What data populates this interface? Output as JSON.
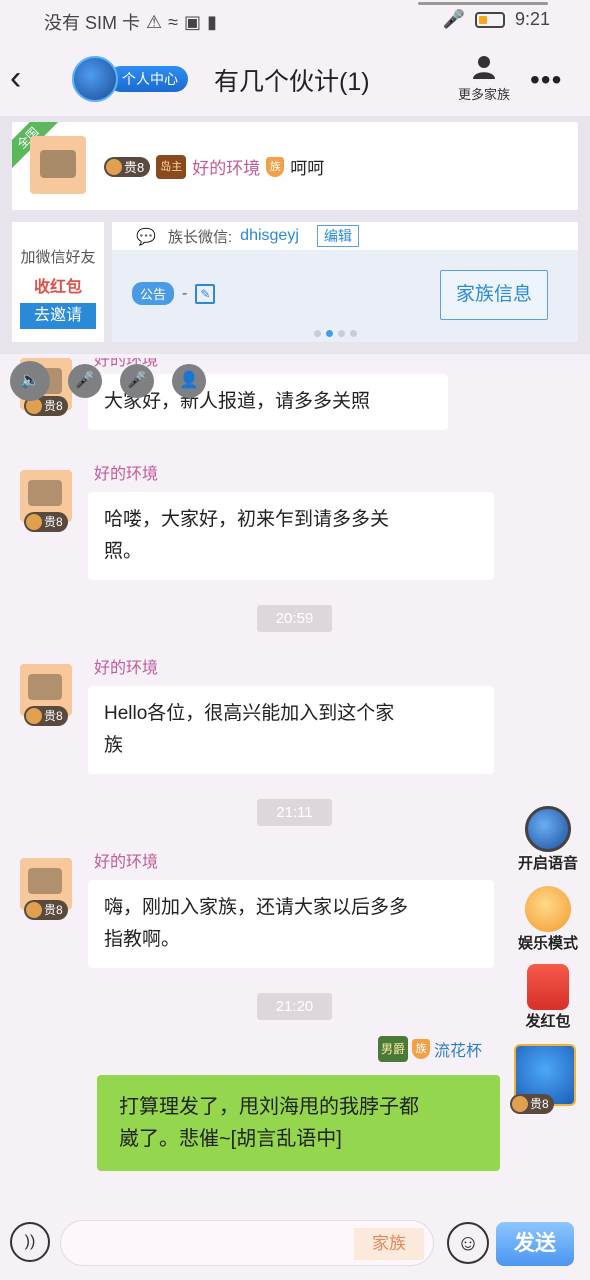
{
  "status_bar": {
    "carrier": "没有 SIM 卡",
    "time": "9:21"
  },
  "header": {
    "profile_label": "个人中心",
    "title": "有几个伙计(1)",
    "more_family": "更多家族"
  },
  "banner": {
    "corner_tag": "全国",
    "gui_level": "贵8",
    "island_badge": "岛主",
    "clan_badge": "族",
    "sender": "好的环境",
    "message": "呵呵",
    "invite_line1": "加微信好友",
    "invite_line2": "收红包",
    "invite_button": "去邀请",
    "wechat_label": "族长微信:",
    "wechat_id": "dhisgeyj",
    "edit_label": "编辑",
    "notice_tag": "公告",
    "notice_text": "-",
    "family_info_button": "家族信息"
  },
  "messages": [
    {
      "sender": "好的环境",
      "badge": "贵8",
      "text": "大家好，新人报道，请多多关照"
    },
    {
      "sender": "好的环境",
      "badge": "贵8",
      "text_line1": "哈喽，大家好，初来乍到请多多关",
      "text_line2": "照。"
    },
    {
      "time": "20:59"
    },
    {
      "sender": "好的环境",
      "badge": "贵8",
      "text_line1": "Hello各位，很高兴能加入到这个家",
      "text_line2": "族"
    },
    {
      "time": "21:11"
    },
    {
      "sender": "好的环境",
      "badge": "贵8",
      "text_line1": "嗨，刚加入家族，还请大家以后多多",
      "text_line2": "指教啊。"
    },
    {
      "time": "21:20"
    }
  ],
  "self_message": {
    "rank_badge": "男爵",
    "clan_badge": "族",
    "sender": "流花杯",
    "badge": "贵8",
    "text_line1": "打算理发了，甩刘海甩的我脖子都",
    "text_line2": "崴了。悲催~[胡言乱语中]"
  },
  "floating_actions": {
    "voice": "开启语音",
    "entertainment": "娱乐模式",
    "red_packet": "发红包"
  },
  "input_bar": {
    "placeholder": "",
    "family_chip": "家族",
    "send_label": "发送"
  }
}
